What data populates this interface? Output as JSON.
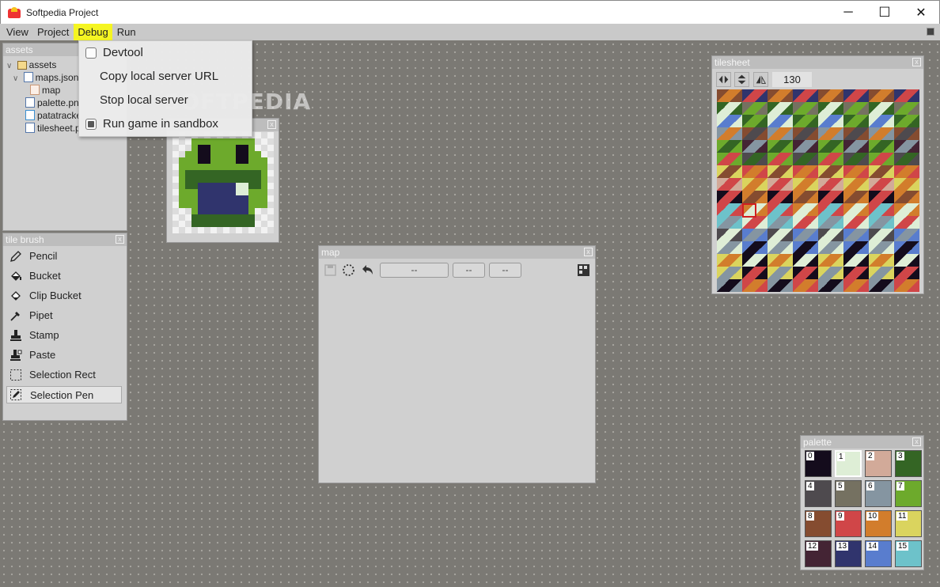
{
  "window": {
    "title": "Softpedia Project",
    "minimize": "─",
    "maximize": "☐",
    "close": "✕"
  },
  "menu": {
    "items": [
      "View",
      "Project",
      "Debug",
      "Run"
    ],
    "active": "Debug",
    "active_color": "#f5f522"
  },
  "debug_menu": {
    "items": [
      {
        "label": "Devtool",
        "checkbox": true,
        "checked": false
      },
      {
        "label": "Copy local server URL",
        "checkbox": false
      },
      {
        "label": "Stop local server",
        "checkbox": false
      },
      {
        "label": "Run game in sandbox",
        "checkbox": true,
        "checked": true
      }
    ]
  },
  "watermark": "SOFTPEDIA",
  "assets": {
    "title": "assets",
    "tree": [
      {
        "label": "assets",
        "icon": "folder-icon",
        "arrow": "∨"
      },
      {
        "label": "maps.json",
        "icon": "file-icon",
        "arrow": "∨"
      },
      {
        "label": "map",
        "icon": "map-icon"
      },
      {
        "label": "palette.png",
        "icon": "file-icon"
      },
      {
        "label": "patatracker",
        "icon": "music-file-icon"
      },
      {
        "label": "tilesheet.png",
        "icon": "file-icon"
      }
    ]
  },
  "sprite_panel": {
    "close": "x"
  },
  "tile_brush": {
    "title": "tile brush",
    "tools": [
      {
        "label": "Pencil",
        "icon": "pencil-icon"
      },
      {
        "label": "Bucket",
        "icon": "bucket-icon"
      },
      {
        "label": "Clip Bucket",
        "icon": "clip-bucket-icon"
      },
      {
        "label": "Pipet",
        "icon": "pipet-icon"
      },
      {
        "label": "Stamp",
        "icon": "stamp-icon"
      },
      {
        "label": "Paste",
        "icon": "paste-icon"
      },
      {
        "label": "Selection Rect",
        "icon": "selection-rect-icon"
      },
      {
        "label": "Selection Pen",
        "icon": "selection-pen-icon",
        "selected": true
      }
    ]
  },
  "map_panel": {
    "title": "map",
    "field1": "--",
    "field2": "--",
    "field3": "--"
  },
  "tilesheet": {
    "title": "tilesheet",
    "zoom": "130"
  },
  "palette": {
    "title": "palette",
    "colors": [
      "#140c1c",
      "#deeed6",
      "#d2aa99",
      "#346524",
      "#4e4a4e",
      "#757161",
      "#8595a1",
      "#6daa2c",
      "#854c30",
      "#d04648",
      "#d27d2c",
      "#dad45e",
      "#442434",
      "#30346d",
      "#597dce",
      "#6dc2ca"
    ],
    "labels": [
      "0",
      "1",
      "2",
      "3",
      "4",
      "5",
      "6",
      "7",
      "8",
      "9",
      "10",
      "11",
      "12",
      "13",
      "14",
      "15"
    ],
    "selected": 1
  }
}
